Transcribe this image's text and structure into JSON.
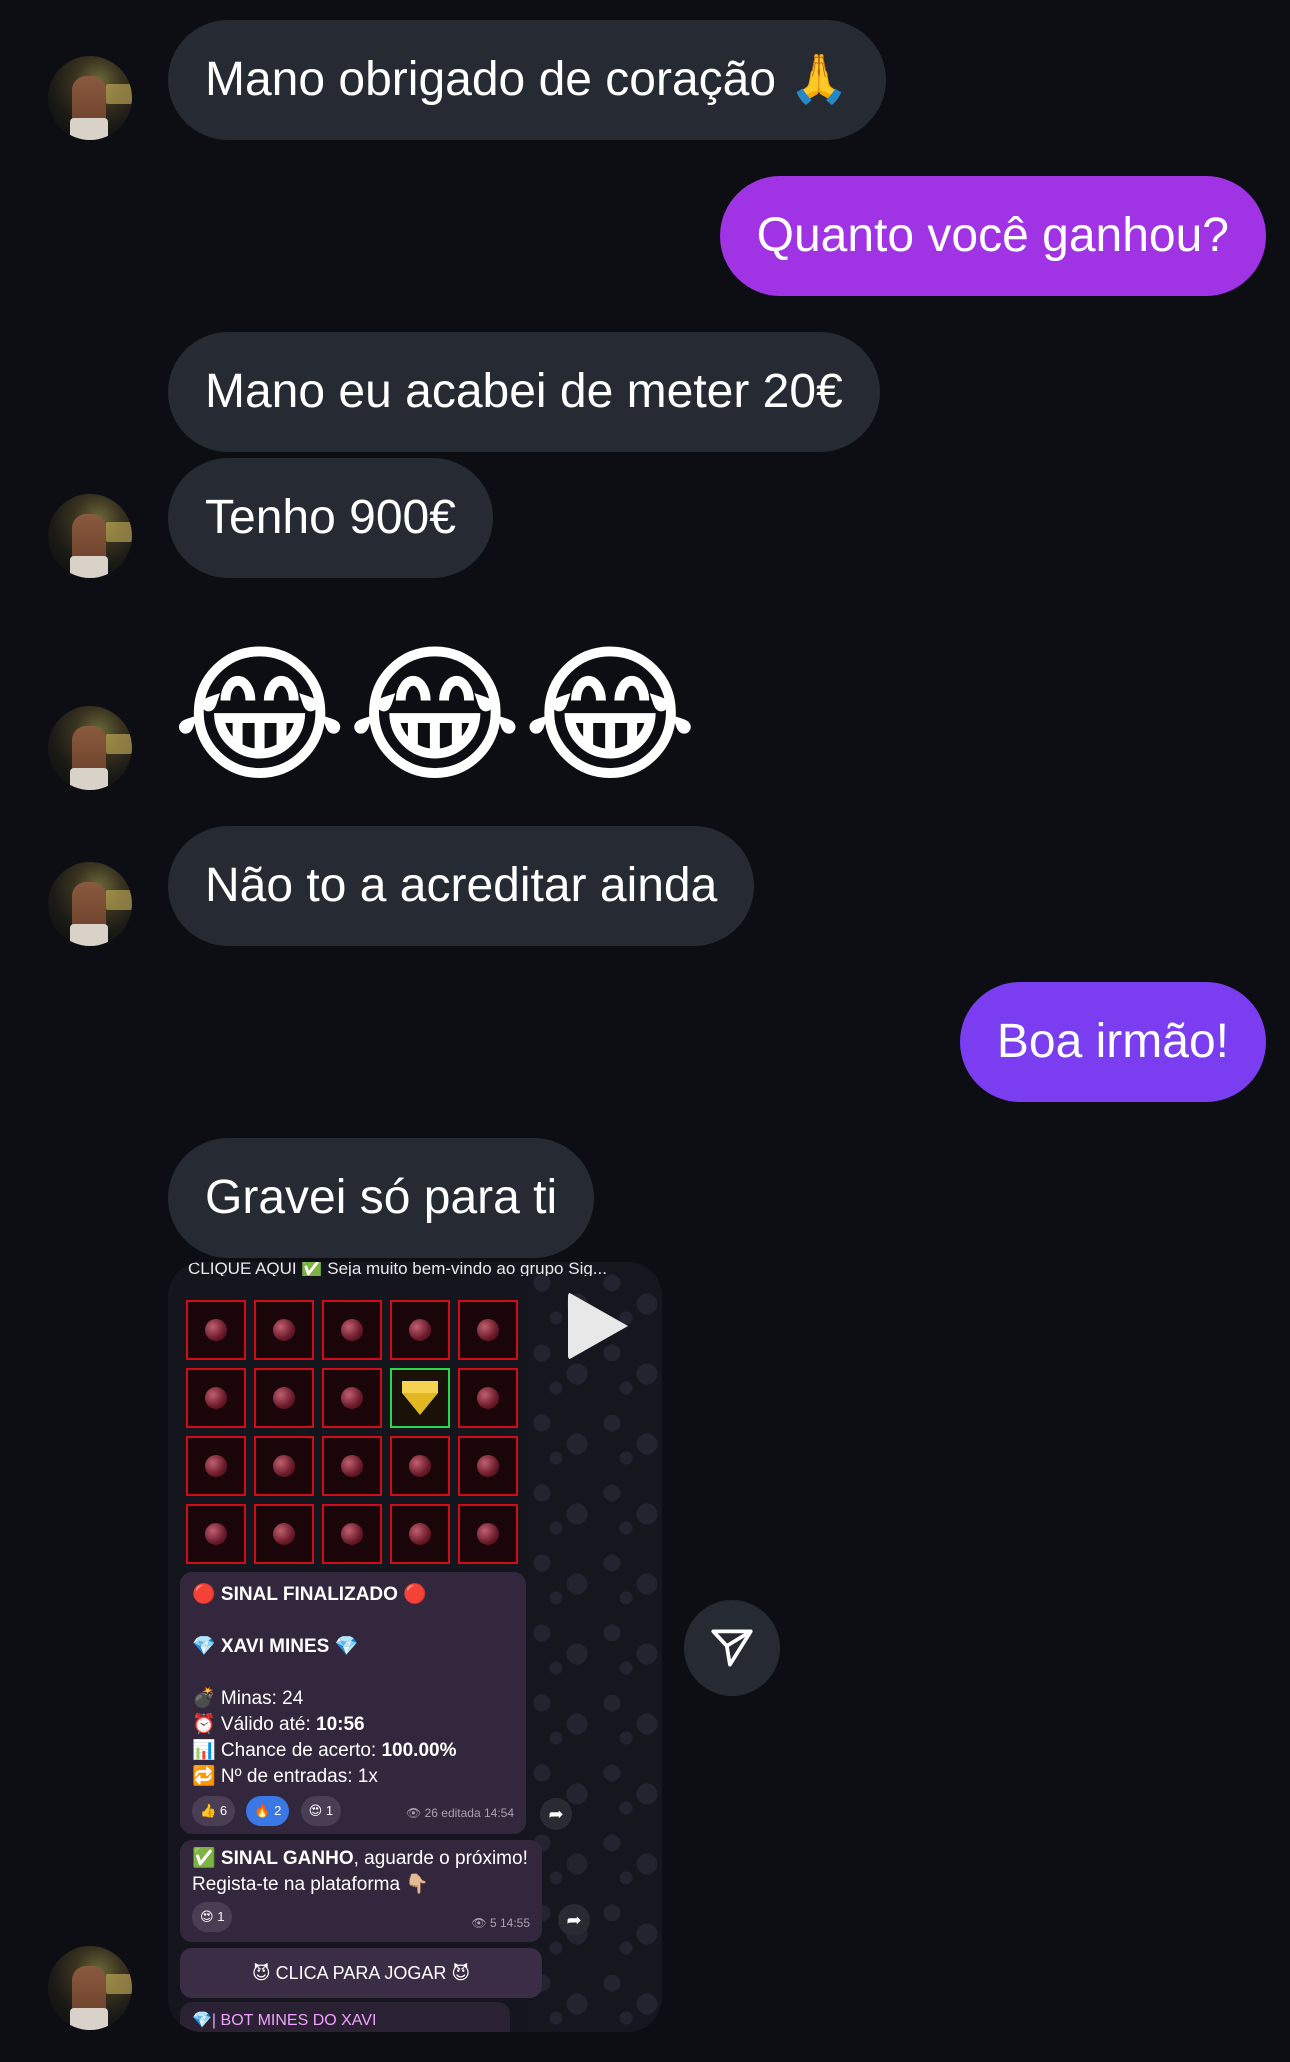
{
  "messages": [
    {
      "from": "them",
      "text": "Mano obrigado de coração 🙏"
    },
    {
      "from": "me",
      "text": "Quanto você ganhou?"
    },
    {
      "from": "them",
      "text": "Mano eu acabei de meter 20€"
    },
    {
      "from": "them",
      "text": "Tenho 900€"
    },
    {
      "from": "them",
      "text": "😂😂😂"
    },
    {
      "from": "them",
      "text": "Não to a acreditar ainda"
    },
    {
      "from": "me",
      "text": "Boa irmão!"
    },
    {
      "from": "them",
      "text": "Gravei só para ti"
    }
  ],
  "video": {
    "top_caption": "CLIQUE AQUI ✅ Seja muito bem-vindo ao grupo Sig...",
    "signal": {
      "title": "🔴 SINAL FINALIZADO 🔴",
      "brand": "💎 XAVI MINES 💎",
      "minas": "💣 Minas: 24",
      "valido_label": "⏰ Válido até: ",
      "valido_value": "10:56",
      "chance_label": "📊 Chance de acerto: ",
      "chance_value": "100.00%",
      "entradas": "🔁 Nº de entradas: 1x",
      "reactions": [
        {
          "emoji": "👍",
          "count": "6"
        },
        {
          "emoji": "🔥",
          "count": "2"
        },
        {
          "emoji": "😍",
          "count": "1"
        }
      ],
      "meta": "👁 26 editada 14:54"
    },
    "ganho": {
      "line1_bold": "✅ SINAL GANHO",
      "line1_rest": ", aguarde o próximo!",
      "line2": "Regista-te na plataforma 👇🏼",
      "reaction_emoji": "😍",
      "reaction_count": "1",
      "meta": "👁 5 14:55"
    },
    "button": "😈 CLICA PARA JOGAR 😈",
    "bot": "💎| BOT MINES DO XAVI"
  },
  "icons": {
    "play": "play-icon",
    "send": "paper-plane-icon",
    "forward": "forward-arrow-icon"
  }
}
